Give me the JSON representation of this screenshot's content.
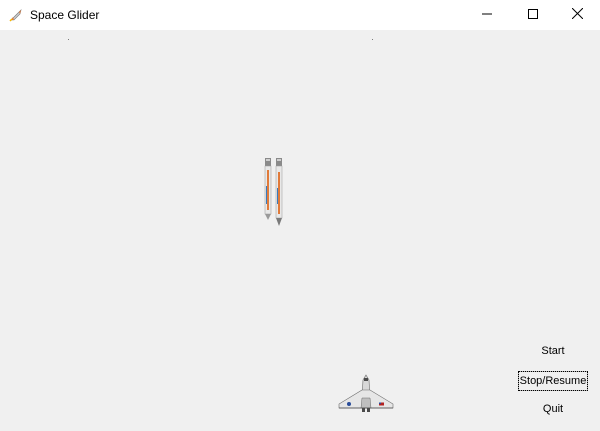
{
  "window": {
    "title": "Space Glider",
    "icon": "rocket-icon",
    "controls": {
      "minimize": "minimize-icon",
      "maximize": "maximize-icon",
      "close": "close-icon"
    }
  },
  "game": {
    "sprites": [
      "twin-rocket-boosters",
      "space-shuttle-glider"
    ]
  },
  "controls": {
    "start_label": "Start",
    "stop_resume_label": "Stop/Resume",
    "quit_label": "Quit"
  },
  "colors": {
    "client_background": "#f0f0f0",
    "titlebar_background": "#ffffff",
    "booster_orange": "#e07a3a",
    "shuttle_body": "#d8d8d8"
  }
}
